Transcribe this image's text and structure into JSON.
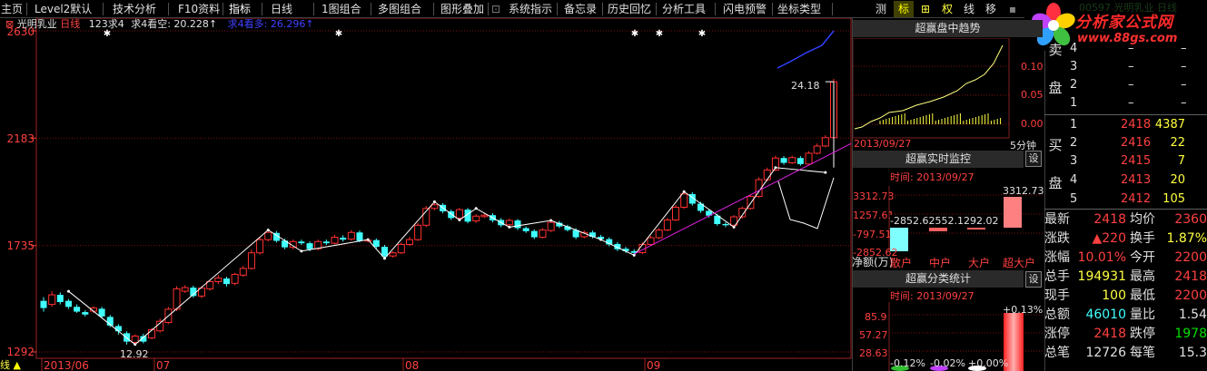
{
  "menu": [
    "主页",
    "Level2默认",
    "技术分析",
    "F10资料",
    "指标",
    "日线",
    "1图组合",
    "多图组合",
    "图形叠加",
    "系统指示",
    "备忘录",
    "历史回忆",
    "分析工具",
    "闪电预警",
    "坐标类型"
  ],
  "menu_active": "指标",
  "right_tabs": [
    "测",
    "标",
    "⊞",
    "权",
    "线",
    "移"
  ],
  "logo": {
    "title": "分析家公式网",
    "url": "www.88gs.com",
    "watermark": "00597 光明乳业 日线"
  },
  "chart_header": {
    "stock": "光明乳业",
    "period": "日线",
    "indicator": "123求4",
    "series1_label": "求4看空: 20.228↑",
    "series2_label": "求4看多: 26.296↑"
  },
  "y_axis": [
    "2630",
    "2183",
    "1735",
    "1292"
  ],
  "x_axis": [
    "2013/06",
    "07",
    "08",
    "09"
  ],
  "annotations": {
    "low": "12.92",
    "high": "24.18"
  },
  "cursor_label": "线",
  "trend_panel": {
    "title": "超赢盘中趋势",
    "scale": [
      "0.10",
      "0.05",
      "0.00"
    ],
    "date": "2013/09/27",
    "interval": "5分钟"
  },
  "monitor_panel": {
    "title": "超赢实时监控",
    "setting": "设",
    "time": "时间: 2013/09/27",
    "top_value": "3312.73",
    "scale": [
      "3312.73",
      "1257.61",
      "-797.51",
      "-2852.62"
    ],
    "values": "-2852.62552.1292.02",
    "categories": [
      "净额(万)",
      "散户",
      "中户",
      "大户",
      "超大户"
    ]
  },
  "class_panel": {
    "title": "超赢分类统计",
    "setting": "设",
    "time": "时间: 2013/09/27",
    "top_value": "+0.13%",
    "scale": [
      "85.9",
      "57.27",
      "28.63"
    ],
    "bottom_values": [
      "-0.12%",
      "-0.02%",
      "+0.00%"
    ]
  },
  "order_book": {
    "sell_label": [
      "卖",
      "盘"
    ],
    "buy_label": [
      "买",
      "盘"
    ],
    "sell": [
      {
        "level": "4",
        "price": "–",
        "volume": "–"
      },
      {
        "level": "3",
        "price": "–",
        "volume": "–"
      },
      {
        "level": "2",
        "price": "–",
        "volume": "–"
      },
      {
        "level": "1",
        "price": "–",
        "volume": "–"
      }
    ],
    "buy": [
      {
        "level": "1",
        "price": "2418",
        "volume": "4387"
      },
      {
        "level": "2",
        "price": "2416",
        "volume": "22"
      },
      {
        "level": "3",
        "price": "2415",
        "volume": "7"
      },
      {
        "level": "4",
        "price": "2413",
        "volume": "20"
      },
      {
        "level": "5",
        "price": "2412",
        "volume": "105"
      }
    ]
  },
  "stats": [
    {
      "l1": "最新",
      "v1": "2418",
      "c1": "#ff4040",
      "l2": "均价",
      "v2": "2360",
      "c2": "#ff4040"
    },
    {
      "l1": "涨跌",
      "v1": "▲220",
      "c1": "#ff4040",
      "l2": "换手",
      "v2": "1.87%",
      "c2": "#ffff40"
    },
    {
      "l1": "涨幅",
      "v1": "10.01%",
      "c1": "#ff4040",
      "l2": "今开",
      "v2": "2200",
      "c2": "#ff4040"
    },
    {
      "l1": "总手",
      "v1": "194931",
      "c1": "#ffff40",
      "l2": "最高",
      "v2": "2418",
      "c2": "#ff4040"
    },
    {
      "l1": "现手",
      "v1": "100",
      "c1": "#ffff40",
      "l2": "最低",
      "v2": "2200",
      "c2": "#ff4040"
    },
    {
      "l1": "总额",
      "v1": "46010",
      "c1": "#40ffff",
      "l2": "量比",
      "v2": "1.54",
      "c2": "#e0e0e0"
    },
    {
      "l1": "涨停",
      "v1": "2418",
      "c1": "#ff4040",
      "l2": "跌停",
      "v2": "1978",
      "c2": "#00e000"
    },
    {
      "l1": "总笔",
      "v1": "12726",
      "c1": "#e0e0e0",
      "l2": "每笔",
      "v2": "15.3",
      "c2": "#e0e0e0"
    }
  ],
  "chart_data": {
    "type": "candlestick",
    "ylim": [
      1292,
      2630
    ],
    "candles": [
      [
        1505,
        1475,
        1520,
        1460
      ],
      [
        1490,
        1530,
        1545,
        1480
      ],
      [
        1530,
        1500,
        1540,
        1490
      ],
      [
        1505,
        1480,
        1512,
        1472
      ],
      [
        1480,
        1460,
        1490,
        1455
      ],
      [
        1458,
        1448,
        1466,
        1440
      ],
      [
        1462,
        1475,
        1482,
        1455
      ],
      [
        1472,
        1440,
        1480,
        1432
      ],
      [
        1438,
        1402,
        1446,
        1395
      ],
      [
        1400,
        1378,
        1408,
        1365
      ],
      [
        1370,
        1335,
        1378,
        1323
      ],
      [
        1332,
        1358,
        1365,
        1325
      ],
      [
        1358,
        1335,
        1368,
        1328
      ],
      [
        1350,
        1385,
        1392,
        1345
      ],
      [
        1380,
        1420,
        1432,
        1373
      ],
      [
        1415,
        1470,
        1480,
        1408
      ],
      [
        1470,
        1555,
        1566,
        1462
      ],
      [
        1545,
        1560,
        1570,
        1538
      ],
      [
        1560,
        1525,
        1568,
        1518
      ],
      [
        1525,
        1558,
        1566,
        1516
      ],
      [
        1555,
        1585,
        1592,
        1548
      ],
      [
        1585,
        1600,
        1612,
        1575
      ],
      [
        1598,
        1575,
        1605,
        1565
      ],
      [
        1578,
        1615,
        1622,
        1570
      ],
      [
        1612,
        1640,
        1650,
        1605
      ],
      [
        1640,
        1705,
        1718,
        1635
      ],
      [
        1705,
        1760,
        1772,
        1698
      ],
      [
        1760,
        1790,
        1800,
        1752
      ],
      [
        1788,
        1755,
        1796,
        1748
      ],
      [
        1756,
        1728,
        1764,
        1720
      ],
      [
        1728,
        1752,
        1760,
        1720
      ],
      [
        1752,
        1745,
        1760,
        1738
      ],
      [
        1745,
        1720,
        1752,
        1712
      ],
      [
        1722,
        1752,
        1760,
        1715
      ],
      [
        1752,
        1745,
        1760,
        1738
      ],
      [
        1745,
        1770,
        1780,
        1740
      ],
      [
        1768,
        1760,
        1778,
        1752
      ],
      [
        1762,
        1790,
        1800,
        1755
      ],
      [
        1790,
        1755,
        1798,
        1750
      ],
      [
        1755,
        1758,
        1765,
        1748
      ],
      [
        1758,
        1730,
        1765,
        1722
      ],
      [
        1730,
        1690,
        1738,
        1682
      ],
      [
        1692,
        1705,
        1712,
        1685
      ],
      [
        1705,
        1740,
        1748,
        1700
      ],
      [
        1740,
        1760,
        1772,
        1734
      ],
      [
        1760,
        1820,
        1830,
        1755
      ],
      [
        1820,
        1890,
        1900,
        1812
      ],
      [
        1890,
        1905,
        1918,
        1882
      ],
      [
        1905,
        1878,
        1912,
        1870
      ],
      [
        1878,
        1850,
        1885,
        1842
      ],
      [
        1850,
        1885,
        1892,
        1845
      ],
      [
        1885,
        1835,
        1892,
        1828
      ],
      [
        1838,
        1858,
        1866,
        1830
      ],
      [
        1856,
        1862,
        1872,
        1850
      ],
      [
        1862,
        1840,
        1870,
        1832
      ],
      [
        1842,
        1820,
        1850,
        1812
      ],
      [
        1822,
        1840,
        1848,
        1815
      ],
      [
        1840,
        1808,
        1846,
        1800
      ],
      [
        1808,
        1795,
        1815,
        1788
      ],
      [
        1796,
        1770,
        1803,
        1762
      ],
      [
        1770,
        1800,
        1808,
        1765
      ],
      [
        1798,
        1832,
        1840,
        1792
      ],
      [
        1830,
        1815,
        1838,
        1808
      ],
      [
        1815,
        1800,
        1822,
        1794
      ],
      [
        1800,
        1770,
        1808,
        1762
      ],
      [
        1772,
        1790,
        1798,
        1765
      ],
      [
        1790,
        1772,
        1798,
        1765
      ],
      [
        1772,
        1762,
        1780,
        1755
      ],
      [
        1762,
        1740,
        1770,
        1732
      ],
      [
        1742,
        1720,
        1750,
        1712
      ],
      [
        1722,
        1712,
        1730,
        1705
      ],
      [
        1712,
        1705,
        1720,
        1695
      ],
      [
        1706,
        1740,
        1748,
        1700
      ],
      [
        1740,
        1768,
        1776,
        1735
      ],
      [
        1768,
        1800,
        1808,
        1762
      ],
      [
        1800,
        1842,
        1850,
        1795
      ],
      [
        1842,
        1895,
        1905,
        1838
      ],
      [
        1895,
        1950,
        1960,
        1888
      ],
      [
        1950,
        1910,
        1958,
        1902
      ],
      [
        1910,
        1880,
        1918,
        1872
      ],
      [
        1880,
        1860,
        1888,
        1852
      ],
      [
        1860,
        1825,
        1868,
        1818
      ],
      [
        1825,
        1820,
        1832,
        1812
      ],
      [
        1820,
        1855,
        1862,
        1815
      ],
      [
        1855,
        1890,
        1898,
        1848
      ],
      [
        1890,
        1940,
        1948,
        1885
      ],
      [
        1940,
        2010,
        2020,
        1935
      ],
      [
        2010,
        2050,
        2060,
        2002
      ],
      [
        2050,
        2100,
        2110,
        2045
      ],
      [
        2100,
        2080,
        2108,
        2072
      ],
      [
        2080,
        2102,
        2110,
        2075
      ],
      [
        2100,
        2075,
        2108,
        2068
      ],
      [
        2075,
        2120,
        2128,
        2070
      ],
      [
        2120,
        2150,
        2160,
        2115
      ],
      [
        2150,
        2185,
        2195,
        2145
      ],
      [
        2185,
        2418,
        2430,
        2180
      ]
    ]
  }
}
